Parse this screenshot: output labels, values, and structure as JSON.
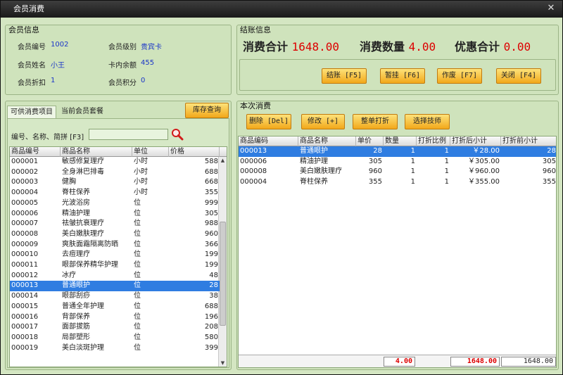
{
  "window": {
    "title": "会员消费",
    "close_glyph": "✕"
  },
  "member": {
    "title": "会员信息",
    "fields": [
      {
        "label": "会员编号",
        "value": "1002"
      },
      {
        "label": "会员级别",
        "value": "贵宾卡"
      },
      {
        "label": "会员姓名",
        "value": "小王"
      },
      {
        "label": "卡内余额",
        "value": "455"
      },
      {
        "label": "会员折扣",
        "value": "1"
      },
      {
        "label": "会员积分",
        "value": "0"
      }
    ]
  },
  "checkout": {
    "title": "结账信息",
    "total_label": "消费合计",
    "total_value": "1648.00",
    "qty_label": "消费数量",
    "qty_value": "4.00",
    "discount_label": "优惠合计",
    "discount_value": "0.00",
    "buttons": [
      "结账 [F5]",
      "暂挂 [F6]",
      "作废 [F7]",
      "关闭 [F4]"
    ]
  },
  "left": {
    "tabs": [
      "可供消费项目",
      "当前会员套餐"
    ],
    "stock_button": "库存查询",
    "search_label": "编号、名称、简拼 [F3]",
    "search_value": "",
    "columns": [
      "商品编号",
      "商品名称",
      "单位",
      "价格"
    ],
    "rows": [
      [
        "000001",
        "敏感修复理疗",
        "小时",
        "588"
      ],
      [
        "000002",
        "全身淋巴排毒",
        "小时",
        "688"
      ],
      [
        "000003",
        "健胸",
        "小时",
        "668"
      ],
      [
        "000004",
        "脊柱保养",
        "小时",
        "355"
      ],
      [
        "000005",
        "光波浴房",
        "位",
        "999"
      ],
      [
        "000006",
        "精油护理",
        "位",
        "305"
      ],
      [
        "000007",
        "祛皱抗衰理疗",
        "位",
        "988"
      ],
      [
        "000008",
        "美白嫩肤理疗",
        "位",
        "960"
      ],
      [
        "000009",
        "爽肤面霜隔离防晒",
        "位",
        "366"
      ],
      [
        "000010",
        "去痘理疗",
        "位",
        "199"
      ],
      [
        "000011",
        "眼部保养精华护理",
        "位",
        "199"
      ],
      [
        "000012",
        "冰疗",
        "位",
        "48"
      ],
      [
        "000013",
        "普通眼护",
        "位",
        "28"
      ],
      [
        "000014",
        "眼部刮痧",
        "位",
        "38"
      ],
      [
        "000015",
        "普通全年护理",
        "位",
        "688"
      ],
      [
        "000016",
        "背部保养",
        "位",
        "196"
      ],
      [
        "000017",
        "面部拔筋",
        "位",
        "208"
      ],
      [
        "000018",
        "局部塑形",
        "位",
        "580"
      ],
      [
        "000019",
        "美白淡斑护理",
        "位",
        "399"
      ]
    ],
    "selected_index": 12
  },
  "current": {
    "title": "本次消费",
    "buttons": [
      "删除 [Del]",
      "修改 [+]",
      "整单打折",
      "选择技师"
    ],
    "columns": [
      "商品编码",
      "商品名称",
      "单价",
      "数量",
      "打折比例",
      "打折后小计",
      "打折前小计"
    ],
    "rows": [
      [
        "000013",
        "普通眼护",
        "28",
        "1",
        "1",
        "￥28.00",
        "28"
      ],
      [
        "000006",
        "精油护理",
        "305",
        "1",
        "1",
        "￥305.00",
        "305"
      ],
      [
        "000008",
        "美白嫩肤理疗",
        "960",
        "1",
        "1",
        "￥960.00",
        "960"
      ],
      [
        "000004",
        "脊柱保养",
        "355",
        "1",
        "1",
        "￥355.00",
        "355"
      ]
    ],
    "selected_index": 0,
    "footer": {
      "qty": "4.00",
      "after": "1648.00",
      "before": "1648.00"
    }
  }
}
